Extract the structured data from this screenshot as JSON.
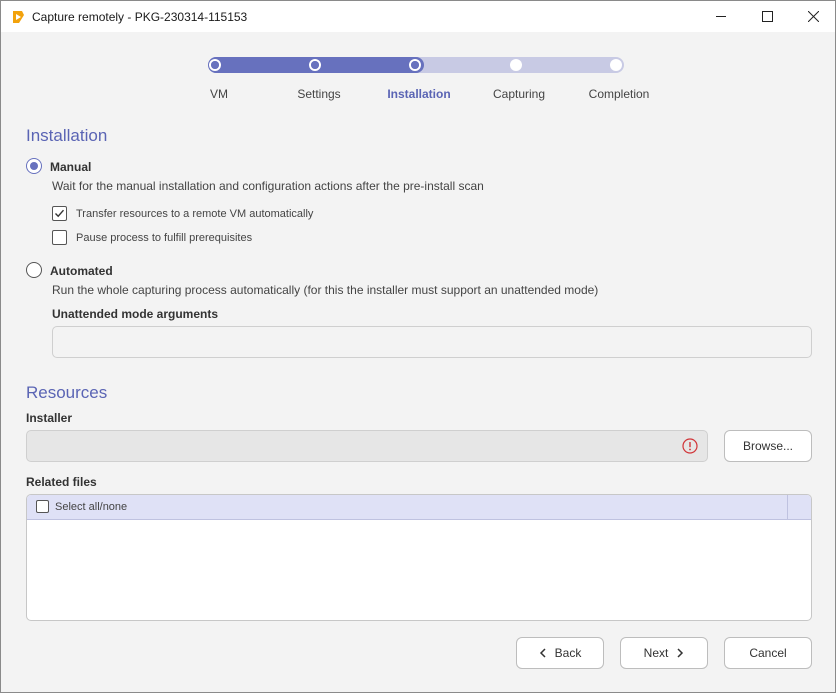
{
  "window": {
    "title": "Capture remotely - PKG-230314-115153"
  },
  "stepper": {
    "steps": [
      "VM",
      "Settings",
      "Installation",
      "Capturing",
      "Completion"
    ],
    "active": "Installation",
    "progress_fraction": 0.5
  },
  "installation": {
    "title": "Installation",
    "manual": {
      "label": "Manual",
      "selected": true,
      "description": "Wait for the manual installation and configuration actions after the pre-install scan",
      "transfer_label": "Transfer resources to a remote VM automatically",
      "transfer_checked": true,
      "pause_label": "Pause process to fulfill prerequisites",
      "pause_checked": false
    },
    "automated": {
      "label": "Automated",
      "selected": false,
      "description": "Run the whole capturing process automatically (for this the installer must support an unattended mode)",
      "args_label": "Unattended mode arguments",
      "args_value": ""
    }
  },
  "resources": {
    "title": "Resources",
    "installer_label": "Installer",
    "installer_value": "",
    "browse_label": "Browse...",
    "related_files_label": "Related files",
    "select_all_label": "Select all/none"
  },
  "footer": {
    "back_label": "Back",
    "next_label": "Next",
    "cancel_label": "Cancel"
  },
  "colors": {
    "accent": "#6771be",
    "accent_light": "#c8cae4",
    "error": "#d13438"
  }
}
